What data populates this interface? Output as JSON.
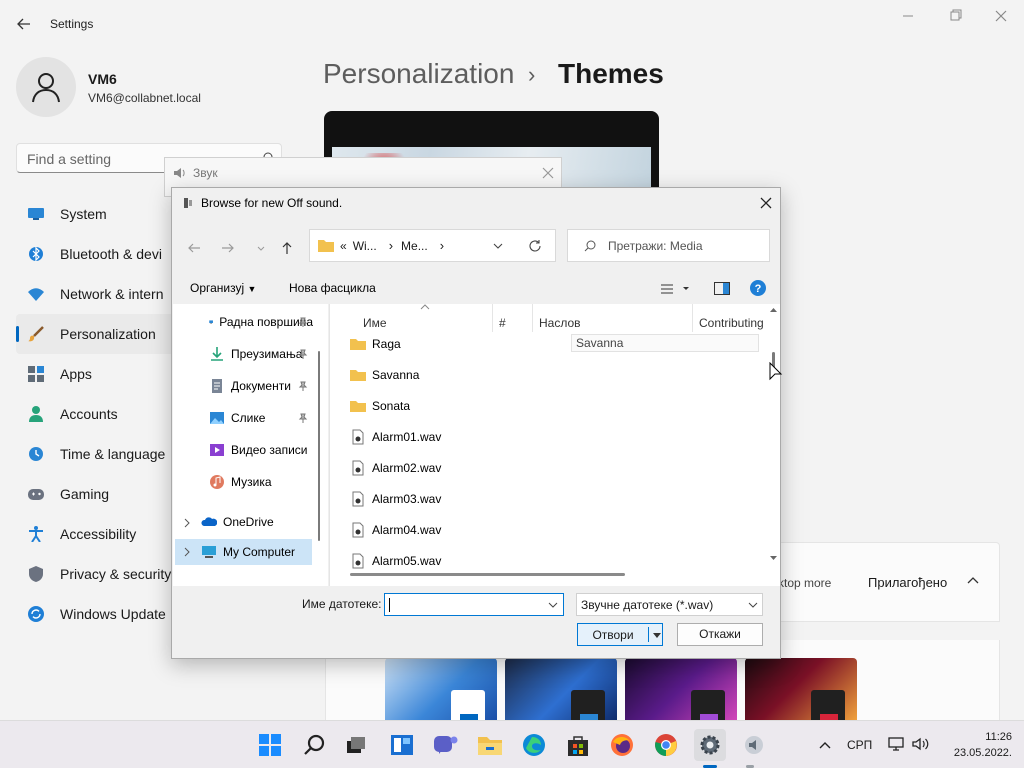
{
  "settings": {
    "window_title": "Settings",
    "user": {
      "name": "VM6",
      "email": "VM6@collabnet.local"
    },
    "search_placeholder": "Find a setting",
    "nav": [
      {
        "label": "System",
        "icon": "monitor-icon"
      },
      {
        "label": "Bluetooth & devi",
        "icon": "bluetooth-icon"
      },
      {
        "label": "Network & intern",
        "icon": "wifi-icon"
      },
      {
        "label": "Personalization",
        "icon": "brush-icon",
        "active": true
      },
      {
        "label": "Apps",
        "icon": "apps-icon"
      },
      {
        "label": "Accounts",
        "icon": "person-icon"
      },
      {
        "label": "Time & language",
        "icon": "globe-clock-icon"
      },
      {
        "label": "Gaming",
        "icon": "gamepad-icon"
      },
      {
        "label": "Accessibility",
        "icon": "accessibility-icon"
      },
      {
        "label": "Privacy & security",
        "icon": "shield-icon"
      },
      {
        "label": "Windows Update",
        "icon": "update-icon"
      }
    ],
    "breadcrumb": {
      "parent": "Personalization",
      "separator": "›",
      "current": "Themes"
    },
    "customize": {
      "desktop_text": "ktop more",
      "label": "Прилагођено"
    }
  },
  "sound_dialog": {
    "title": "Звук"
  },
  "file_dialog": {
    "title": "Browse for new Off sound.",
    "address": {
      "prefix": "«",
      "segments": [
        "Wi...",
        "Me..."
      ]
    },
    "search_placeholder": "Претражи: Media",
    "commands": {
      "organize": "Организуј",
      "new_folder": "Нова фасцикла"
    },
    "tree": [
      {
        "label": "Радна површина",
        "icon": "desktop-icon",
        "pinned": true
      },
      {
        "label": "Преузимања",
        "icon": "download-icon",
        "pinned": true
      },
      {
        "label": "Документи",
        "icon": "documents-icon",
        "pinned": true
      },
      {
        "label": "Слике",
        "icon": "pictures-icon",
        "pinned": true
      },
      {
        "label": "Видео записи",
        "icon": "videos-icon",
        "pinned": false
      },
      {
        "label": "Музика",
        "icon": "music-icon",
        "pinned": false
      },
      {
        "label": "OneDrive",
        "icon": "onedrive-icon",
        "pinned": false
      },
      {
        "label": "My Computer",
        "icon": "computer-icon",
        "pinned": false
      }
    ],
    "columns": [
      "Име",
      "#",
      "Наслов",
      "Contributing"
    ],
    "title_edit_value": "Savanna",
    "files": [
      {
        "name": "Raga",
        "type": "folder"
      },
      {
        "name": "Savanna",
        "type": "folder"
      },
      {
        "name": "Sonata",
        "type": "folder"
      },
      {
        "name": "Alarm01.wav",
        "type": "wav"
      },
      {
        "name": "Alarm02.wav",
        "type": "wav"
      },
      {
        "name": "Alarm03.wav",
        "type": "wav"
      },
      {
        "name": "Alarm04.wav",
        "type": "wav"
      },
      {
        "name": "Alarm05.wav",
        "type": "wav"
      }
    ],
    "file_name_label": "Име датотеке:",
    "file_name_value": "",
    "file_type": "Звучне датотеке (*.wav)",
    "open_label": "Отвори",
    "cancel_label": "Откажи"
  },
  "taskbar": {
    "apps": [
      "start-icon",
      "search-icon",
      "task-view-icon",
      "widgets-icon",
      "teams-chat-icon",
      "file-explorer-icon",
      "edge-icon",
      "store-icon",
      "firefox-icon",
      "chrome-icon",
      "settings-icon",
      "sound-icon"
    ],
    "language": "СРП",
    "time": "11:26",
    "date": "23.05.2022."
  },
  "colors": {
    "accent": "#0067c0",
    "dialog_accent": "#0078d4",
    "folder": "#f2c14e"
  }
}
